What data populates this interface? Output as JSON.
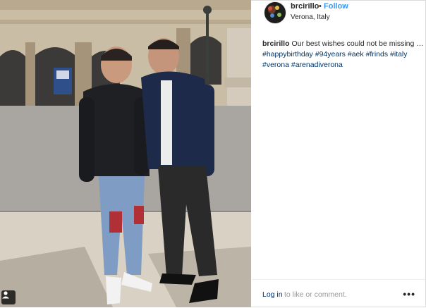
{
  "post": {
    "username": "brcirillo",
    "separator": "•",
    "follow_label": "Follow",
    "location": "Verona, Italy",
    "caption": {
      "user": "brcirillo",
      "text": "Our best wishes could not be missing …",
      "hashtags": [
        "#happybirthday",
        "#94years",
        "#aek",
        "#frinds",
        "#italy",
        "#verona",
        "#arenadiverona"
      ]
    }
  },
  "footer": {
    "login_label": "Log in",
    "login_rest": "to like or comment.",
    "more_label": "•••"
  },
  "icons": {
    "photo_badge": "user-tag-icon",
    "more": "more-options-icon"
  },
  "colors": {
    "link_blue": "#3897f0",
    "hashtag": "#003569",
    "muted": "#999999",
    "text": "#262626"
  }
}
